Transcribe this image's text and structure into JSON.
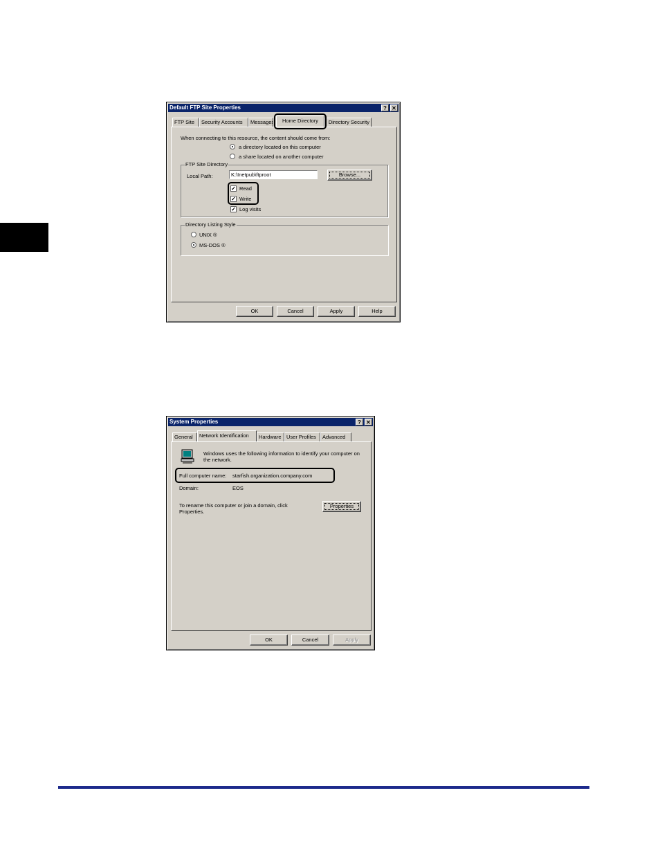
{
  "ftp_dialog": {
    "title": "Default FTP Site Properties",
    "help_btn": "?",
    "close_btn": "✕",
    "tabs": [
      "FTP Site",
      "Security Accounts",
      "Messages",
      "Home Directory",
      "Directory Security"
    ],
    "active_tab": "Home Directory",
    "intro": "When connecting to this resource, the content should come from:",
    "source_options": [
      "a directory located on this computer",
      "a share located on another computer"
    ],
    "source_selected": "a directory located on this computer",
    "site_dir_group": "FTP Site Directory",
    "local_path_label": "Local Path:",
    "local_path_value": "K:\\Inetpub\\ftproot",
    "browse_btn": "Browse...",
    "permissions": [
      {
        "label": "Read",
        "checked": true
      },
      {
        "label": "Write",
        "checked": true
      },
      {
        "label": "Log visits",
        "checked": true
      }
    ],
    "listing_group": "Directory Listing Style",
    "listing_options": [
      "UNIX ®",
      "MS-DOS ®"
    ],
    "listing_selected": "MS-DOS ®",
    "buttons": [
      "OK",
      "Cancel",
      "Apply",
      "Help"
    ]
  },
  "sys_dialog": {
    "title": "System Properties",
    "help_btn": "?",
    "close_btn": "✕",
    "tabs": [
      "General",
      "Network Identification",
      "Hardware",
      "User Profiles",
      "Advanced"
    ],
    "active_tab": "Network Identification",
    "intro": "Windows uses the following information to identify your computer on the network.",
    "full_name_label": "Full computer name:",
    "full_name_value": "starfish.organization.company.com",
    "domain_label": "Domain:",
    "domain_value": "EOS",
    "rename_text": "To rename this computer or join a domain, click Properties.",
    "properties_btn": "Properties",
    "buttons": [
      "OK",
      "Cancel",
      "Apply"
    ]
  },
  "colors": {
    "title_bar": "#0a246a",
    "dialog_face": "#d4d0c8",
    "footer_rule": "#1d2a8c"
  }
}
